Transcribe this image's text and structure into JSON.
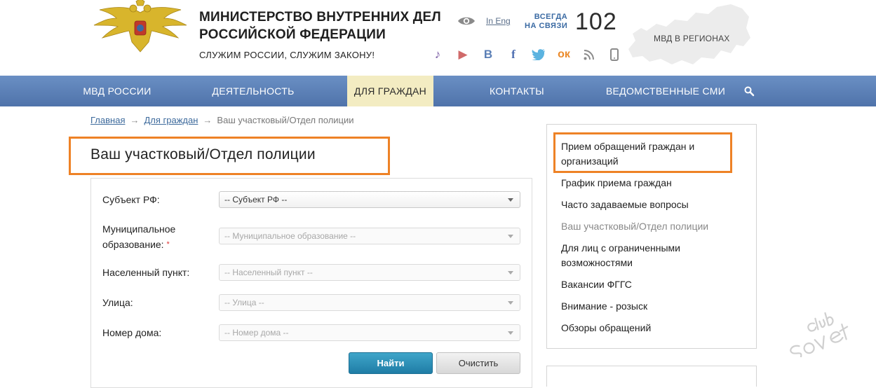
{
  "header": {
    "org_title_line1": "МИНИСТЕРСТВО ВНУТРЕННИХ ДЕЛ",
    "org_title_line2": "РОССИЙСКОЙ ФЕДЕРАЦИИ",
    "slogan": "СЛУЖИМ РОССИИ, СЛУЖИМ ЗАКОНУ!",
    "lang_link": "In Eng",
    "always_line1": "ВСЕГДА",
    "always_line2": "НА СВЯЗИ",
    "hotline": "102",
    "regions_label": "МВД В РЕГИОНАХ",
    "socials": [
      "music-icon",
      "play-icon",
      "vk-icon",
      "facebook-icon",
      "twitter-icon",
      "odnoklassniki-icon",
      "rss-icon",
      "mobile-icon"
    ]
  },
  "nav": {
    "items": [
      {
        "label": "МВД РОССИИ"
      },
      {
        "label": "ДЕЯТЕЛЬНОСТЬ"
      },
      {
        "label": "ДЛЯ ГРАЖДАН"
      },
      {
        "label": "КОНТАКТЫ"
      },
      {
        "label": "ВЕДОМСТВЕННЫЕ СМИ"
      }
    ],
    "active_index": 2
  },
  "breadcrumb": {
    "home": "Главная",
    "section": "Для граждан",
    "current": "Ваш участковый/Отдел полиции",
    "separator": "→"
  },
  "page": {
    "title": "Ваш участковый/Отдел полиции"
  },
  "form": {
    "fields": [
      {
        "label": "Субъект РФ:",
        "value": "-- Субъект РФ --"
      },
      {
        "label_line1": "Муниципальное",
        "label_line2": "образование:",
        "required_mark": "*",
        "value": "-- Муниципальное образование --"
      },
      {
        "label": "Населенный пункт:",
        "value": "-- Населенный пункт --"
      },
      {
        "label": "Улица:",
        "value": "-- Улица --"
      },
      {
        "label": "Номер дома:",
        "value": "-- Номер дома --"
      }
    ],
    "find_button": "Найти",
    "clear_button": "Очистить"
  },
  "sidebar": {
    "items": [
      {
        "label_line1": "Прием обращений граждан и",
        "label_line2": "организаций"
      },
      {
        "label": "График приема граждан"
      },
      {
        "label": "Часто задаваемые вопросы"
      },
      {
        "label": "Ваш участковый/Отдел полиции"
      },
      {
        "label_line1": "Для лиц с ограниченными",
        "label_line2": "возможностями"
      },
      {
        "label": "Вакансии ФГГС"
      },
      {
        "label": "Внимание - розыск"
      },
      {
        "label": "Обзоры обращений"
      }
    ]
  },
  "colors": {
    "nav_bg": "#5b7fb6",
    "nav_active_bg": "#f3ecc2",
    "highlight_border": "#ee8226",
    "link": "#3d6a9c",
    "primary_button": "#2a8fb8"
  }
}
